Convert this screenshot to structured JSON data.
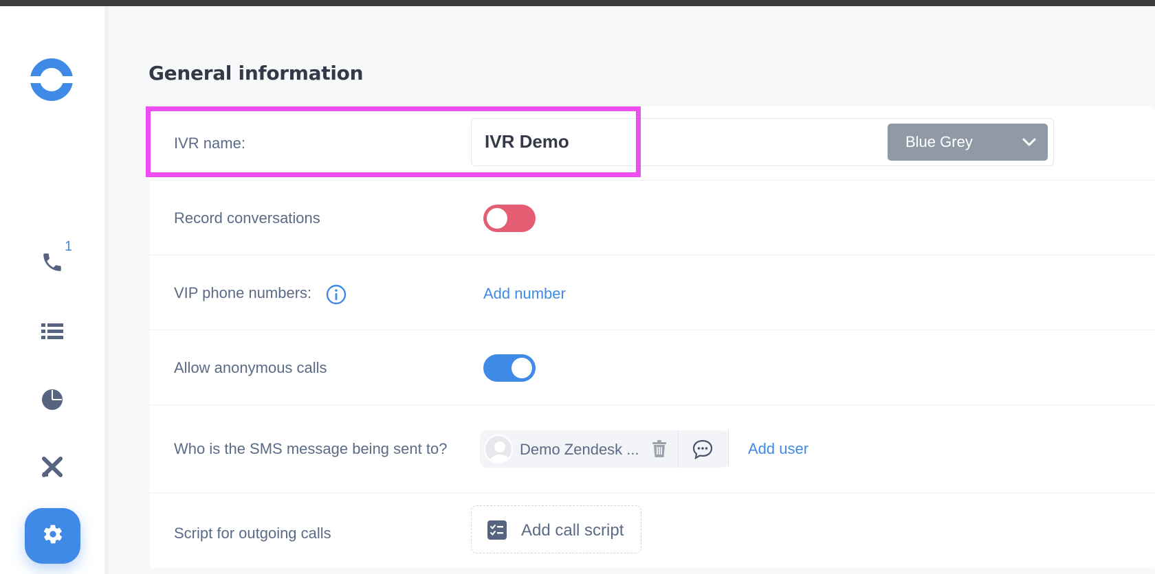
{
  "sidebar": {
    "logo": "app-logo",
    "nav": [
      {
        "icon": "phone-icon",
        "badge": "1"
      },
      {
        "icon": "list-icon"
      },
      {
        "icon": "pie-chart-icon"
      },
      {
        "icon": "tools-icon"
      },
      {
        "icon": "gear-icon"
      }
    ]
  },
  "page": {
    "title": "General information"
  },
  "form": {
    "ivr_name": {
      "label": "IVR name:",
      "value": "IVR Demo"
    },
    "color": {
      "selected": "Blue Grey",
      "swatch": "#8f9aa6"
    },
    "record_conversations": {
      "label": "Record conversations",
      "enabled": false
    },
    "vip_numbers": {
      "label": "VIP phone numbers:",
      "add_label": "Add number"
    },
    "anonymous_calls": {
      "label": "Allow anonymous calls",
      "enabled": true
    },
    "sms_recipients": {
      "label": "Who is the SMS message being sent to?",
      "users": [
        {
          "name": "Demo Zendesk ..."
        }
      ],
      "add_label": "Add user"
    },
    "outgoing_script": {
      "label": "Script for outgoing calls",
      "add_label": "Add call script"
    }
  },
  "colors": {
    "accent": "#3f8ae6",
    "toggle_off": "#e35d73",
    "highlight": "#ef4ff2"
  }
}
